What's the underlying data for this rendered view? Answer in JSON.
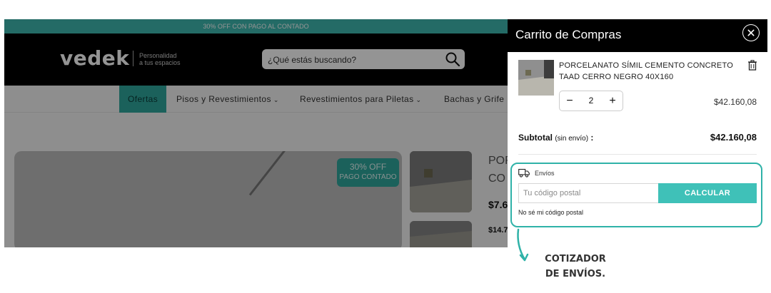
{
  "store": {
    "promo": "30% OFF CON PAGO AL CONTADO",
    "logo": "vedek",
    "tagline_1": "Personalidad",
    "tagline_2": "a tus espacios",
    "search_placeholder": "¿Qué estás buscando?",
    "nav": [
      {
        "label": "Ofertas",
        "active": true
      },
      {
        "label": "Pisos y Revestimientos"
      },
      {
        "label": "Revestimientos para Piletas"
      },
      {
        "label": "Bachas y Grife"
      }
    ],
    "badge": {
      "line1": "30% OFF",
      "line2": "PAGO CONTADO"
    },
    "product_title_1": "POR",
    "product_title_2": "CO",
    "price_1": "$7.6",
    "price_2": "$14.7"
  },
  "cart": {
    "title": "Carrito de Compras",
    "item": {
      "name": "PORCELANATO SÍMIL CEMENTO CONCRETO TAAD CERRO NEGRO 40X160",
      "qty": "2",
      "price": "$42.160,08"
    },
    "subtotal_label": "Subtotal",
    "subtotal_note": "(sin envío)",
    "subtotal_colon": ":",
    "subtotal_value": "$42.160,08",
    "shipping": {
      "label": "Envíos",
      "postal_placeholder": "Tu código postal",
      "calc_button": "CALCULAR",
      "unknown_link": "No sé mi código postal"
    }
  },
  "annotation": {
    "line1": "COTIZADOR",
    "line2": "DE ENVÍOS."
  },
  "colors": {
    "accent": "#3fc1b8",
    "accent_dark": "#2fa79e",
    "header_black": "#000000"
  }
}
